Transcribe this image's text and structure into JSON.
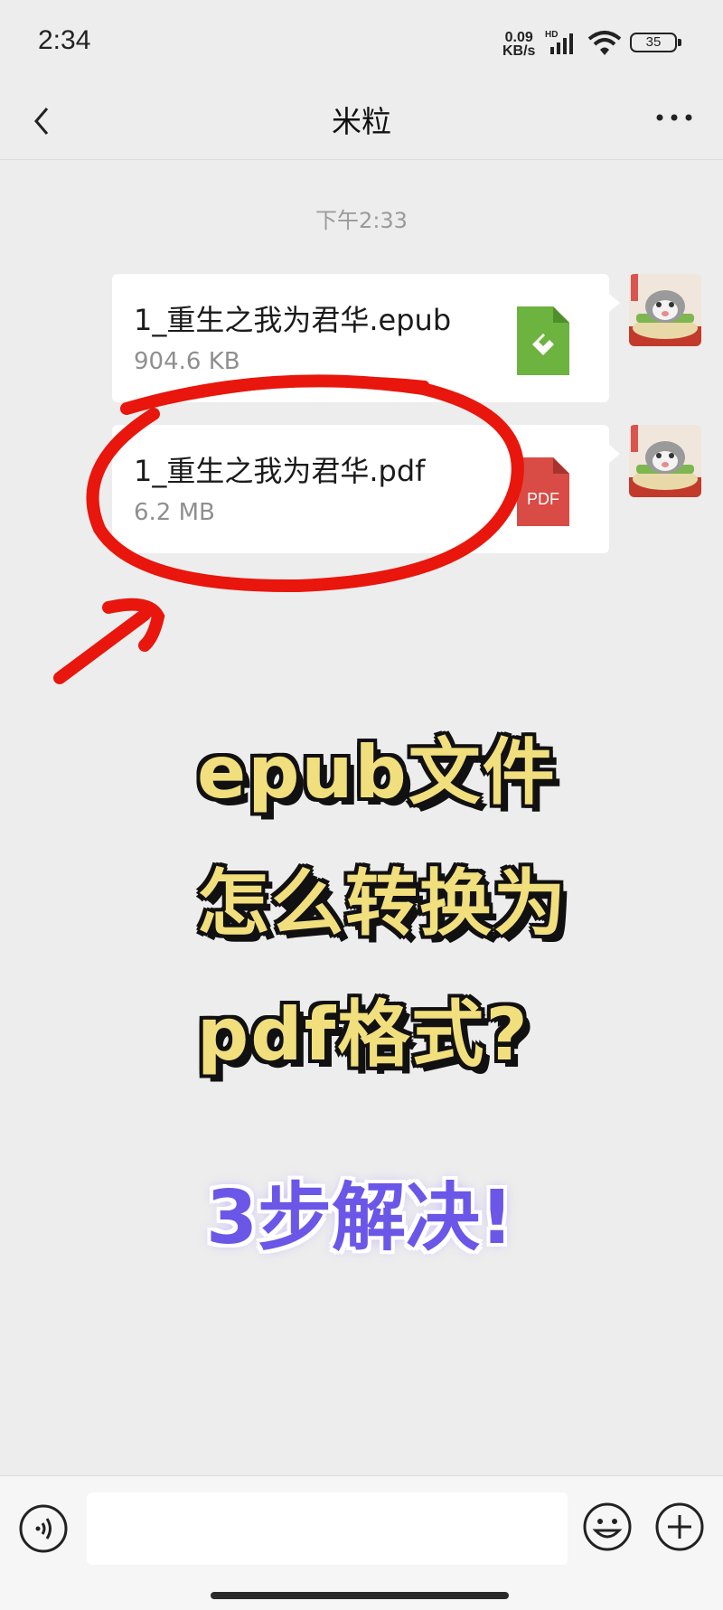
{
  "status_bar": {
    "time": "2:34",
    "net_speed_value": "0.09",
    "net_speed_unit": "KB/s",
    "network": "HD",
    "battery": "35"
  },
  "nav": {
    "title": "米粒",
    "back_icon": "chevron-left-icon",
    "more_icon": "more-dots-icon"
  },
  "chat": {
    "timestamp": "下午2:33",
    "messages": [
      {
        "file_name": "1_重生之我为君华.epub",
        "file_size": "904.6 KB",
        "file_type": "epub",
        "icon_color": "#6cb33f"
      },
      {
        "file_name": "1_重生之我为君华.pdf",
        "file_size": "6.2 MB",
        "file_type": "pdf",
        "icon_label": "PDF",
        "icon_color": "#d94b45"
      }
    ]
  },
  "overlay": {
    "line1": "epub文件",
    "line2": "怎么转换为",
    "line3": "pdf格式?",
    "line4": "3步解决!",
    "text_color": "#f1df7d",
    "accent_color": "#6a57e8",
    "marker_color": "#e8160c"
  },
  "input_bar": {
    "placeholder": "",
    "voice_icon": "voice-icon",
    "emoji_icon": "emoji-icon",
    "plus_icon": "plus-icon"
  }
}
